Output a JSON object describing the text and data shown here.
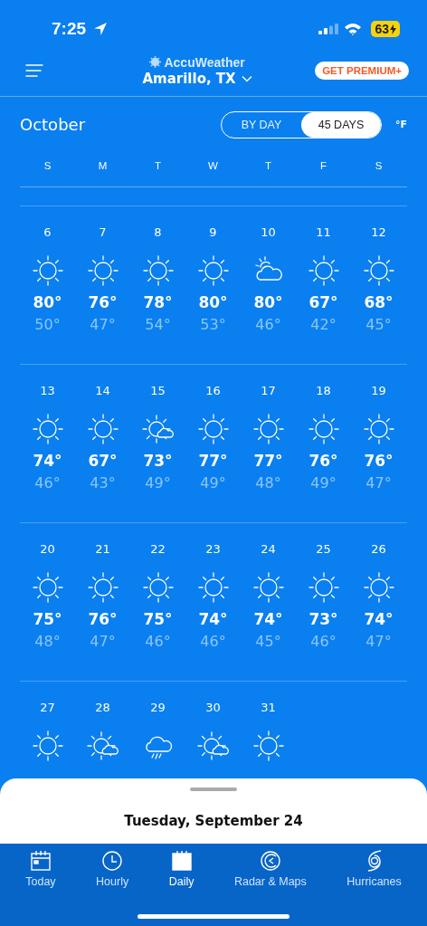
{
  "status_bar": {
    "time": "7:25",
    "battery": "63"
  },
  "header": {
    "brand": "AccuWeather",
    "location": "Amarillo, TX",
    "premium_button": "GET PREMIUM+"
  },
  "calendar": {
    "month": "October",
    "view_toggle": [
      {
        "label": "BY DAY",
        "selected": false
      },
      {
        "label": "45 DAYS",
        "selected": true
      }
    ],
    "unit": "°F",
    "weekdays": [
      "S",
      "M",
      "T",
      "W",
      "T",
      "F",
      "S"
    ],
    "weeks": [
      [
        {
          "date": "6",
          "kind": "sunny",
          "high": "80°",
          "low": "50°"
        },
        {
          "date": "7",
          "kind": "sunny",
          "high": "76°",
          "low": "47°"
        },
        {
          "date": "8",
          "kind": "sunny",
          "high": "78°",
          "low": "54°"
        },
        {
          "date": "9",
          "kind": "sunny",
          "high": "80°",
          "low": "53°"
        },
        {
          "date": "10",
          "kind": "cloudy",
          "high": "80°",
          "low": "46°"
        },
        {
          "date": "11",
          "kind": "sunny",
          "high": "67°",
          "low": "42°"
        },
        {
          "date": "12",
          "kind": "sunny",
          "high": "68°",
          "low": "45°"
        }
      ],
      [
        {
          "date": "13",
          "kind": "sunny",
          "high": "74°",
          "low": "46°"
        },
        {
          "date": "14",
          "kind": "sunny",
          "high": "67°",
          "low": "43°"
        },
        {
          "date": "15",
          "kind": "mostly-sunny",
          "high": "73°",
          "low": "49°"
        },
        {
          "date": "16",
          "kind": "sunny",
          "high": "77°",
          "low": "49°"
        },
        {
          "date": "17",
          "kind": "sunny",
          "high": "77°",
          "low": "48°"
        },
        {
          "date": "18",
          "kind": "sunny",
          "high": "76°",
          "low": "49°"
        },
        {
          "date": "19",
          "kind": "sunny",
          "high": "76°",
          "low": "47°"
        }
      ],
      [
        {
          "date": "20",
          "kind": "sunny",
          "high": "75°",
          "low": "48°"
        },
        {
          "date": "21",
          "kind": "sunny",
          "high": "76°",
          "low": "47°"
        },
        {
          "date": "22",
          "kind": "sunny",
          "high": "75°",
          "low": "46°"
        },
        {
          "date": "23",
          "kind": "sunny",
          "high": "74°",
          "low": "46°"
        },
        {
          "date": "24",
          "kind": "sunny",
          "high": "74°",
          "low": "45°"
        },
        {
          "date": "25",
          "kind": "sunny",
          "high": "73°",
          "low": "46°"
        },
        {
          "date": "26",
          "kind": "sunny",
          "high": "74°",
          "low": "47°"
        }
      ],
      [
        {
          "date": "27",
          "kind": "sunny"
        },
        {
          "date": "28",
          "kind": "mostly-sunny"
        },
        {
          "date": "29",
          "kind": "rain"
        },
        {
          "date": "30",
          "kind": "mostly-sunny"
        },
        {
          "date": "31",
          "kind": "sunny"
        }
      ]
    ]
  },
  "sheet": {
    "title": "Tuesday, September 24"
  },
  "tab_bar": [
    {
      "label": "Today",
      "kind": "today",
      "selected": false
    },
    {
      "label": "Hourly",
      "kind": "hourly",
      "selected": false
    },
    {
      "label": "Daily",
      "kind": "daily",
      "selected": true
    },
    {
      "label": "Radar & Maps",
      "kind": "radar",
      "selected": false
    },
    {
      "label": "Hurricanes",
      "kind": "hurricanes",
      "selected": false
    }
  ]
}
